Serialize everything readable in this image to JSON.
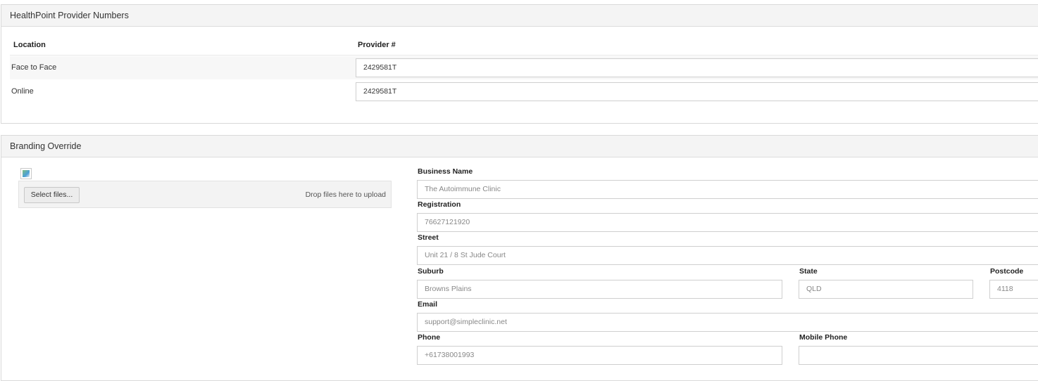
{
  "provider_panel": {
    "title": "HealthPoint Provider Numbers",
    "columns": {
      "location": "Location",
      "provider": "Provider #"
    },
    "rows": [
      {
        "location": "Face to Face",
        "provider": "2429581T"
      },
      {
        "location": "Online",
        "provider": "2429581T"
      }
    ]
  },
  "branding_panel": {
    "title": "Branding Override",
    "upload": {
      "select_label": "Select files...",
      "drop_hint": "Drop files here to upload"
    },
    "fields": {
      "business_name": {
        "label": "Business Name",
        "value": "The Autoimmune Clinic"
      },
      "registration": {
        "label": "Registration",
        "value": "76627121920"
      },
      "street": {
        "label": "Street",
        "value": "Unit 21 / 8 St Jude Court"
      },
      "suburb": {
        "label": "Suburb",
        "value": "Browns Plains"
      },
      "state": {
        "label": "State",
        "value": "QLD"
      },
      "postcode": {
        "label": "Postcode",
        "value": "4118"
      },
      "email": {
        "label": "Email",
        "value": "support@simpleclinic.net"
      },
      "phone": {
        "label": "Phone",
        "value": "+61738001993"
      },
      "mobile_phone": {
        "label": "Mobile Phone",
        "value": ""
      }
    }
  }
}
